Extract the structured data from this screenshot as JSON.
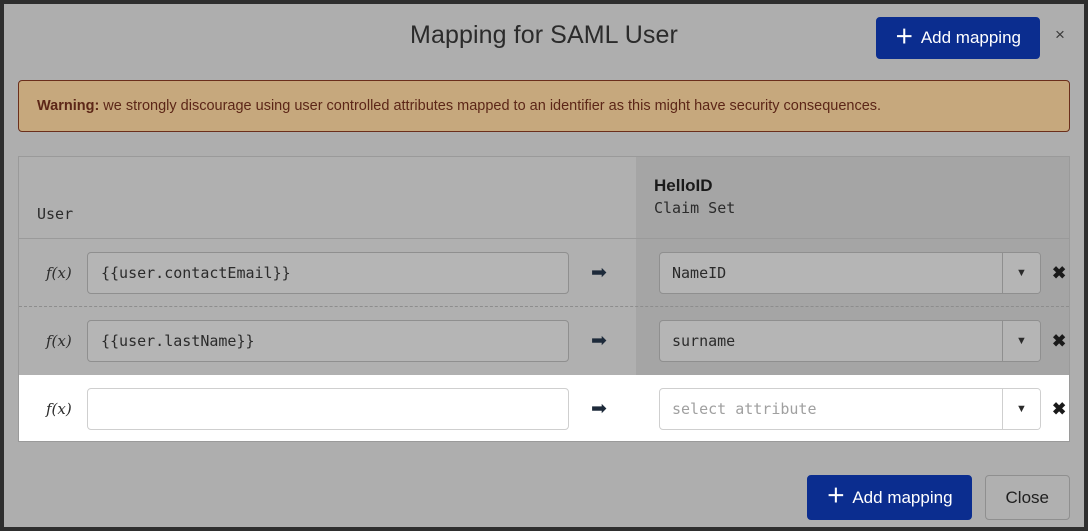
{
  "dialog": {
    "title": "Mapping for SAML User",
    "close_label": "×"
  },
  "header": {
    "add_mapping_label": "Add mapping",
    "plus_icon": "＋"
  },
  "warning": {
    "prefix": "Warning:",
    "text": "we strongly discourage using user controlled attributes mapped to an identifier as this might have security consequences."
  },
  "table": {
    "left_header": "User",
    "right_header_brand": "HelloID",
    "right_header_sub": "Claim Set",
    "fx_label": "f(x)",
    "arrow_glyph": "➡",
    "caret_glyph": "▼",
    "delete_glyph": "✖",
    "expression_placeholder": "",
    "rows": [
      {
        "expression": "{{user.contactEmail}}",
        "attribute": "NameID",
        "attribute_is_placeholder": false
      },
      {
        "expression": "{{user.lastName}}",
        "attribute": "surname",
        "attribute_is_placeholder": false
      },
      {
        "expression": "",
        "attribute": "select attribute",
        "attribute_is_placeholder": true
      }
    ]
  },
  "footer": {
    "add_mapping_label": "Add mapping",
    "plus_icon": "＋",
    "close_label": "Close"
  },
  "colors": {
    "accent": "#0b2d8f",
    "warning_bg": "#c6a87d",
    "warning_border": "#6b2f1c",
    "warning_text": "#5c2617",
    "dialog_bg": "#aeaeae",
    "panel_bg": "#b0b0b0",
    "panel_right_bg": "#a5a5a5"
  }
}
